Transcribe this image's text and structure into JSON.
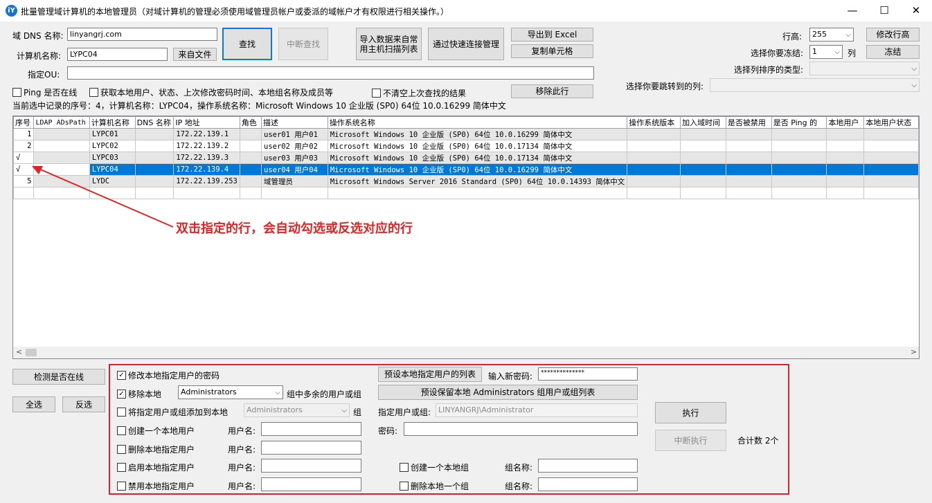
{
  "window": {
    "title": "批量管理域计算机的本地管理员（对域计算机的管理必须使用域管理员帐户或委派的域帐户才有权限进行相关操作。）",
    "icon_letter": "iY",
    "minimize": "—",
    "maximize": "☐",
    "close": "✕"
  },
  "top": {
    "dns_label": "域 DNS 名称:",
    "dns_value": "linyangrj.com",
    "computer_label": "计算机名称:",
    "computer_value": "LYPC04",
    "from_file": "来自文件",
    "ou_label": "指定OU:",
    "ou_value": "",
    "find": "查找",
    "stop_find": "中断查找",
    "import_line1": "导入数据来自常",
    "import_line2": "用主机扫描列表",
    "quick_connect": "通过快速连接管理",
    "export_excel": "导出到 Excel",
    "copy_cell": "复制单元格",
    "remove_row": "移除此行",
    "ping_check": "Ping 是否在线",
    "get_local_check": "获取本地用户、状态、上次修改密码时间、本地组名称及成员等",
    "no_clear_check": "不清空上次查找的结果",
    "status_line": "当前选中记录的序号：4，计算机名称：LYPC04，操作系统名称：Microsoft Windows 10 企业版 (SP0) 64位 10.0.16299 简体中文"
  },
  "right": {
    "row_height_label": "行高:",
    "row_height_value": "255",
    "modify_height": "修改行高",
    "freeze_label": "选择你要冻结:",
    "freeze_value": "1",
    "freeze_unit": "列",
    "freeze_btn": "冻结",
    "sort_label": "选择列排序的类型:",
    "jump_label": "选择你要跳转到的列:"
  },
  "grid": {
    "headers": [
      "序号",
      "LDAP ADsPath",
      "计算机名称",
      "DNS 名称",
      "IP 地址",
      "角色",
      "描述",
      "操作系统名称",
      "操作系统版本",
      "加入域时间",
      "是否被禁用",
      "是否 Ping 的",
      "本地用户",
      "本地用户状态"
    ],
    "rows": [
      {
        "no": "1",
        "name": "LYPC01",
        "ip": "172.22.139.1",
        "desc": "user01 用户01",
        "os": "Microsoft Windows 10 企业版 (SP0) 64位 10.0.16299 简体中文"
      },
      {
        "no": "2",
        "name": "LYPC02",
        "ip": "172.22.139.2",
        "desc": "user02 用户02",
        "os": "Microsoft Windows 10 企业版 (SP0) 64位 10.0.17134 简体中文"
      },
      {
        "no": "√",
        "name": "LYPC03",
        "ip": "172.22.139.3",
        "desc": "user03 用户03",
        "os": "Microsoft Windows 10 企业版 (SP0) 64位 10.0.17134 简体中文"
      },
      {
        "no": "√",
        "name": "LYPC04",
        "ip": "172.22.139.4",
        "desc": "user04 用户04",
        "os": "Microsoft Windows 10 企业版 (SP0) 64位 10.0.16299 简体中文"
      },
      {
        "no": "5",
        "name": "LYDC",
        "ip": "172.22.139.253",
        "desc": "域管理员",
        "os": "Microsoft Windows Server 2016 Standard (SP0) 64位 10.0.14393 简体中文"
      }
    ]
  },
  "annotation": "双击指定的行，会自动勾选或反选对应的行",
  "bottom_left": {
    "detect_online": "检测是否在线",
    "select_all": "全选",
    "invert": "反选"
  },
  "ops": {
    "change_pw": "修改本地指定用户的密码",
    "preset_list": "预设本地指定用户的列表",
    "new_pw_label": "输入新密码:",
    "new_pw_value": "**************",
    "remove_local": "移除本地",
    "group_value": "Administrators",
    "extra_members": "组中多余的用户或组",
    "preset_keep": "预设保留本地 Administrators 组用户或组列表",
    "add_to_local": "将指定用户或组添加到本地",
    "group_value2": "Administrators",
    "group_suffix": "组",
    "user_or_group_label": "指定用户或组:",
    "user_or_group_value": "LINYANGRJ\\Administrator",
    "create_user": "创建一个本地用户",
    "username_label": "用户名:",
    "password_label": "密码:",
    "delete_user": "删除本地指定用户",
    "enable_user": "启用本地指定用户",
    "disable_user": "禁用本地指定用户",
    "create_group": "创建一个本地组",
    "delete_group": "删除本地一个组",
    "group_name_label": "组名称:",
    "execute": "执行",
    "stop_execute": "中断执行",
    "total": "合计数 2个"
  },
  "colors": {
    "selected_row": "#0078d7",
    "annotation": "#e02424",
    "focus_border": "#0a78d7"
  }
}
